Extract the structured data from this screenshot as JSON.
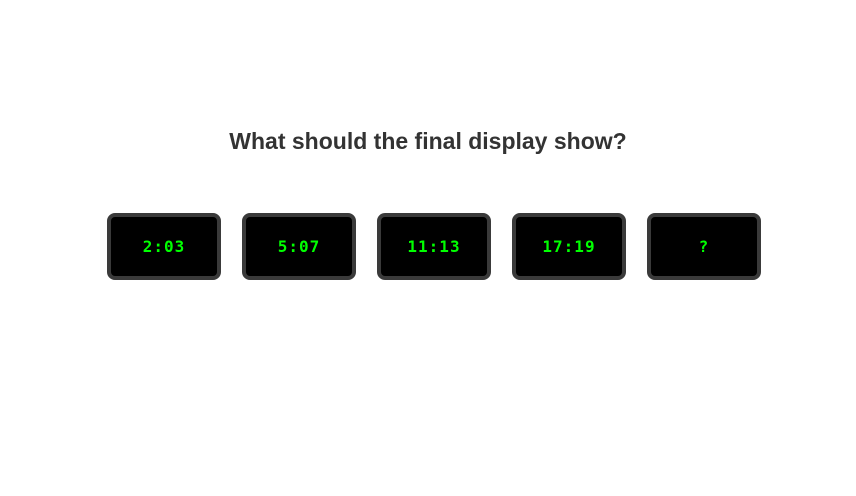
{
  "question": "What should the final display show?",
  "displays": [
    {
      "text": "2:03"
    },
    {
      "text": "5:07"
    },
    {
      "text": "11:13"
    },
    {
      "text": "17:19"
    },
    {
      "text": "?"
    }
  ],
  "colors": {
    "background": "#ffffff",
    "question_text": "#333333",
    "display_bg": "#000000",
    "display_border": "#3a3a3a",
    "digit_color": "#00ff00"
  }
}
